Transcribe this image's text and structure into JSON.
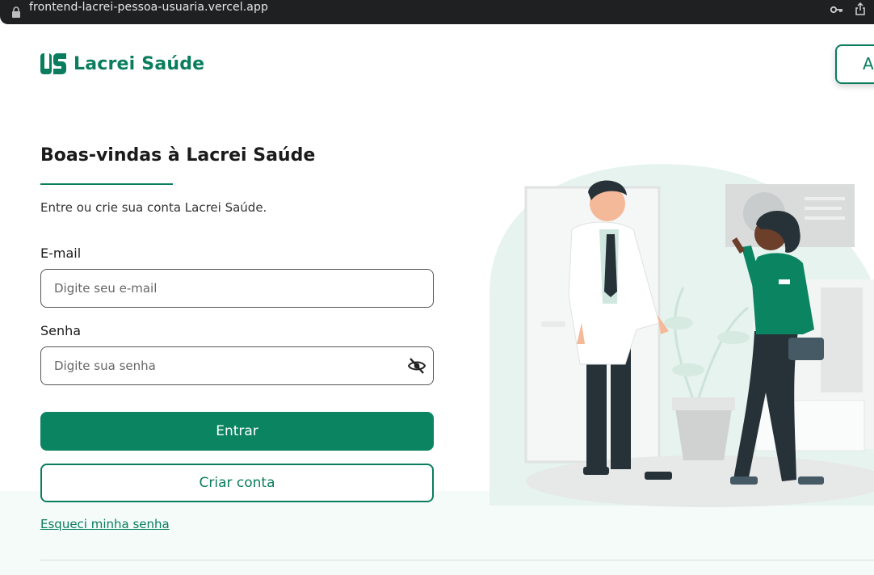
{
  "browser": {
    "url": "frontend-lacrei-pessoa-usuaria.vercel.app",
    "icons": [
      "lock-icon",
      "key-icon",
      "share-icon"
    ]
  },
  "header": {
    "brand": "Lacrei Saúde",
    "top_button_label": "A"
  },
  "form": {
    "title": "Boas-vindas à Lacrei Saúde",
    "subtitle": "Entre ou crie sua conta Lacrei Saúde.",
    "email_label": "E-mail",
    "email_placeholder": "Digite seu e-mail",
    "password_label": "Senha",
    "password_placeholder": "Digite sua senha",
    "login_button": "Entrar",
    "create_button": "Criar conta",
    "forgot_link": "Esqueci minha senha"
  },
  "colors": {
    "brand": "#0a7d5e",
    "primary_button": "#0a8461",
    "chrome": "#1f2022"
  }
}
